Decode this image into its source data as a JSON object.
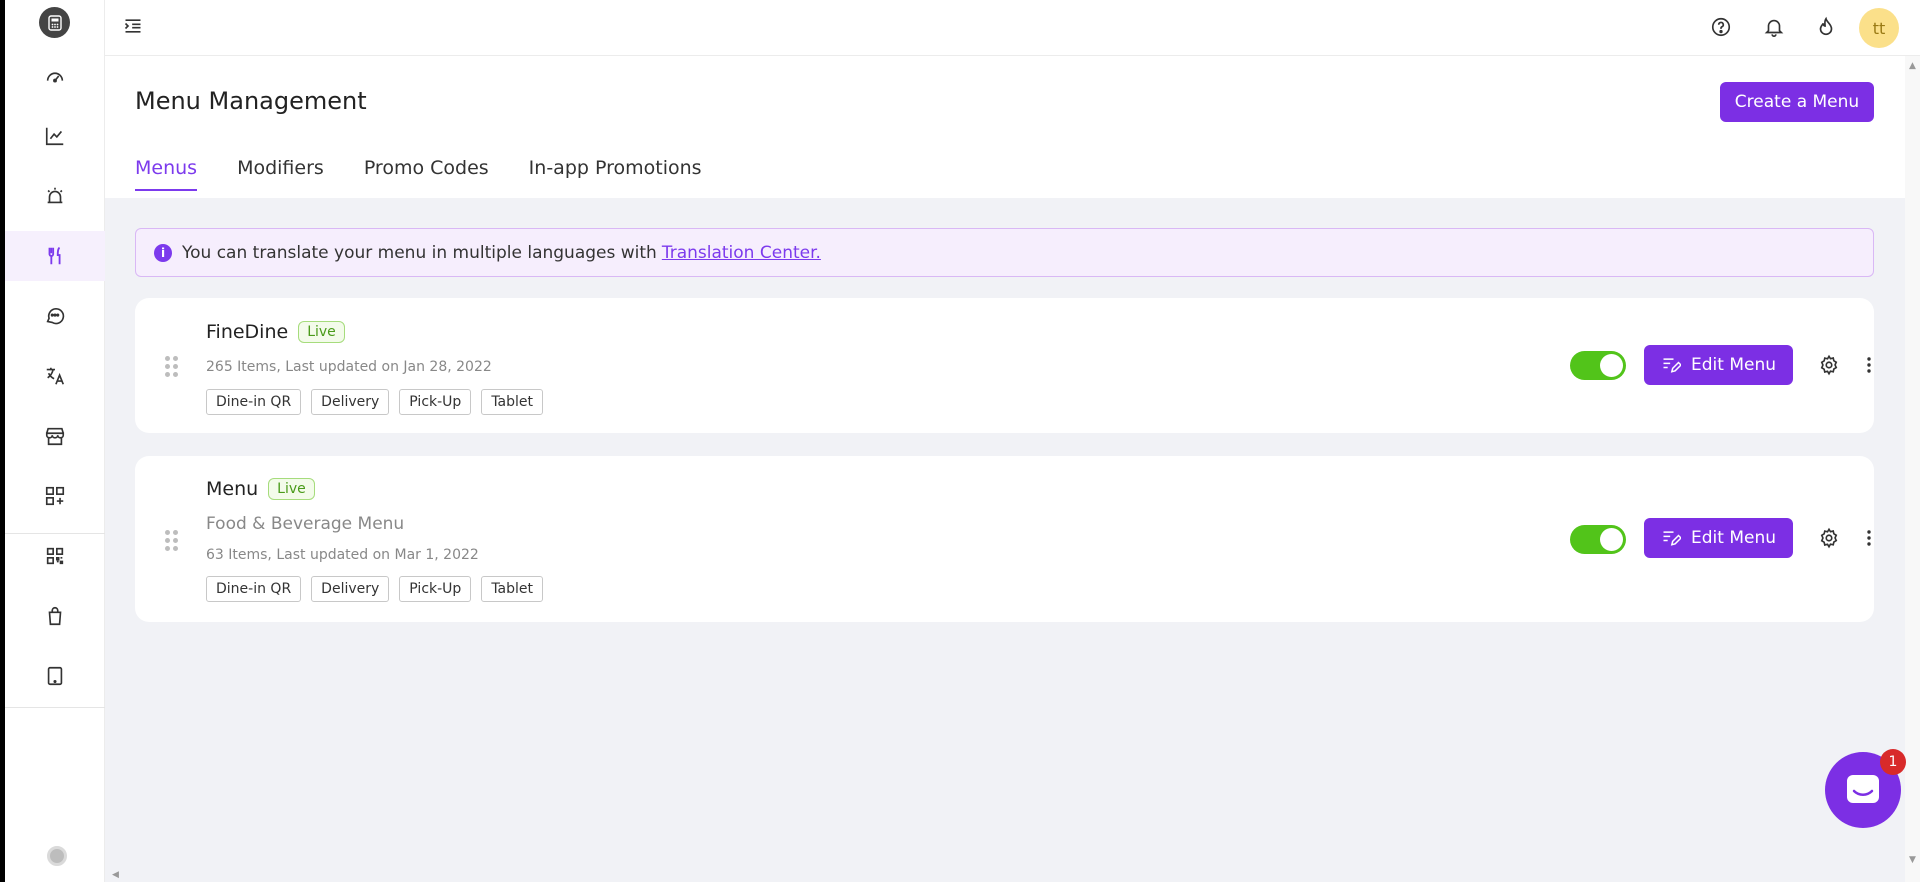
{
  "topbar": {
    "avatar_text": "tt"
  },
  "header": {
    "title": "Menu Management",
    "create_label": "Create a Menu",
    "tabs": [
      {
        "label": "Menus",
        "active": true
      },
      {
        "label": "Modifiers",
        "active": false
      },
      {
        "label": "Promo Codes",
        "active": false
      },
      {
        "label": "In-app Promotions",
        "active": false
      }
    ]
  },
  "banner": {
    "text": "You can translate your menu in multiple languages with",
    "link": "Translation Center.",
    "icon": "info-icon"
  },
  "menus": [
    {
      "name": "FineDine",
      "status": "Live",
      "description": "",
      "meta": "265 Items, Last updated on Jan 28, 2022",
      "channels": [
        "Dine-in QR",
        "Delivery",
        "Pick-Up",
        "Tablet"
      ],
      "enabled": true,
      "edit_label": "Edit Menu"
    },
    {
      "name": "Menu",
      "status": "Live",
      "description": "Food & Beverage Menu",
      "meta": "63 Items, Last updated on Mar 1, 2022",
      "channels": [
        "Dine-in QR",
        "Delivery",
        "Pick-Up",
        "Tablet"
      ],
      "enabled": true,
      "edit_label": "Edit Menu"
    }
  ],
  "chat": {
    "badge_count": "1"
  },
  "colors": {
    "accent": "#7c2fe4",
    "toggle_on": "#52c41a",
    "live": "#4a9b1a",
    "badge": "#d82a2a",
    "content_bg": "#f1f2f6"
  }
}
